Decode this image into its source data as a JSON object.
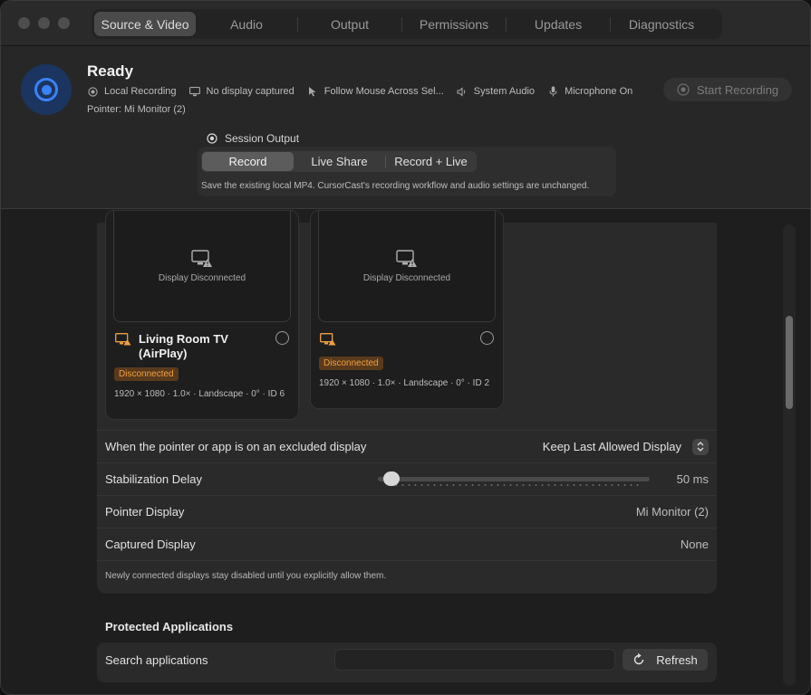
{
  "tabs": [
    {
      "label": "Source & Video",
      "active": true
    },
    {
      "label": "Audio",
      "active": false
    },
    {
      "label": "Output",
      "active": false
    },
    {
      "label": "Permissions",
      "active": false
    },
    {
      "label": "Updates",
      "active": false
    },
    {
      "label": "Diagnostics",
      "active": false
    }
  ],
  "status": {
    "title": "Ready",
    "items": [
      {
        "icon": "record-circle-icon",
        "label": "Local Recording"
      },
      {
        "icon": "display-icon",
        "label": "No display captured"
      },
      {
        "icon": "cursor-icon",
        "label": "Follow Mouse Across Sel..."
      },
      {
        "icon": "speaker-icon",
        "label": "System Audio"
      },
      {
        "icon": "microphone-icon",
        "label": "Microphone On"
      }
    ],
    "pointer": "Pointer: Mi Monitor (2)",
    "start_button": "Start Recording"
  },
  "session": {
    "label": "Session Output",
    "modes": [
      "Record",
      "Live Share",
      "Record + Live"
    ],
    "selected": "Record",
    "note": "Save the existing local MP4. CursorCast's recording workflow and audio settings are unchanged."
  },
  "displays": [
    {
      "preview_text": "Display Disconnected",
      "title": "Living Room TV (AirPlay)",
      "badge": "Disconnected",
      "meta": "1920 × 1080 · 1.0× · Landscape · 0° · ID 6"
    },
    {
      "preview_text": "Display Disconnected",
      "title": "",
      "badge": "Disconnected",
      "meta": "1920 × 1080 · 1.0× · Landscape · 0° · ID 2"
    }
  ],
  "settings": {
    "excluded_label": "When the pointer or app is on an excluded display",
    "excluded_value": "Keep Last Allowed Display",
    "delay_label": "Stabilization Delay",
    "delay_value": "50 ms",
    "delay_fraction": 0.02,
    "pointer_display_label": "Pointer Display",
    "pointer_display_value": "Mi Monitor (2)",
    "captured_display_label": "Captured Display",
    "captured_display_value": "None",
    "note": "Newly connected displays stay disabled until you explicitly allow them."
  },
  "protected": {
    "title": "Protected Applications",
    "search_label": "Search applications",
    "search_value": "",
    "refresh_label": "Refresh"
  },
  "colors": {
    "accent": "#3b82f6",
    "warning": "#f0a040",
    "warning_bg": "#5a3a1c"
  }
}
